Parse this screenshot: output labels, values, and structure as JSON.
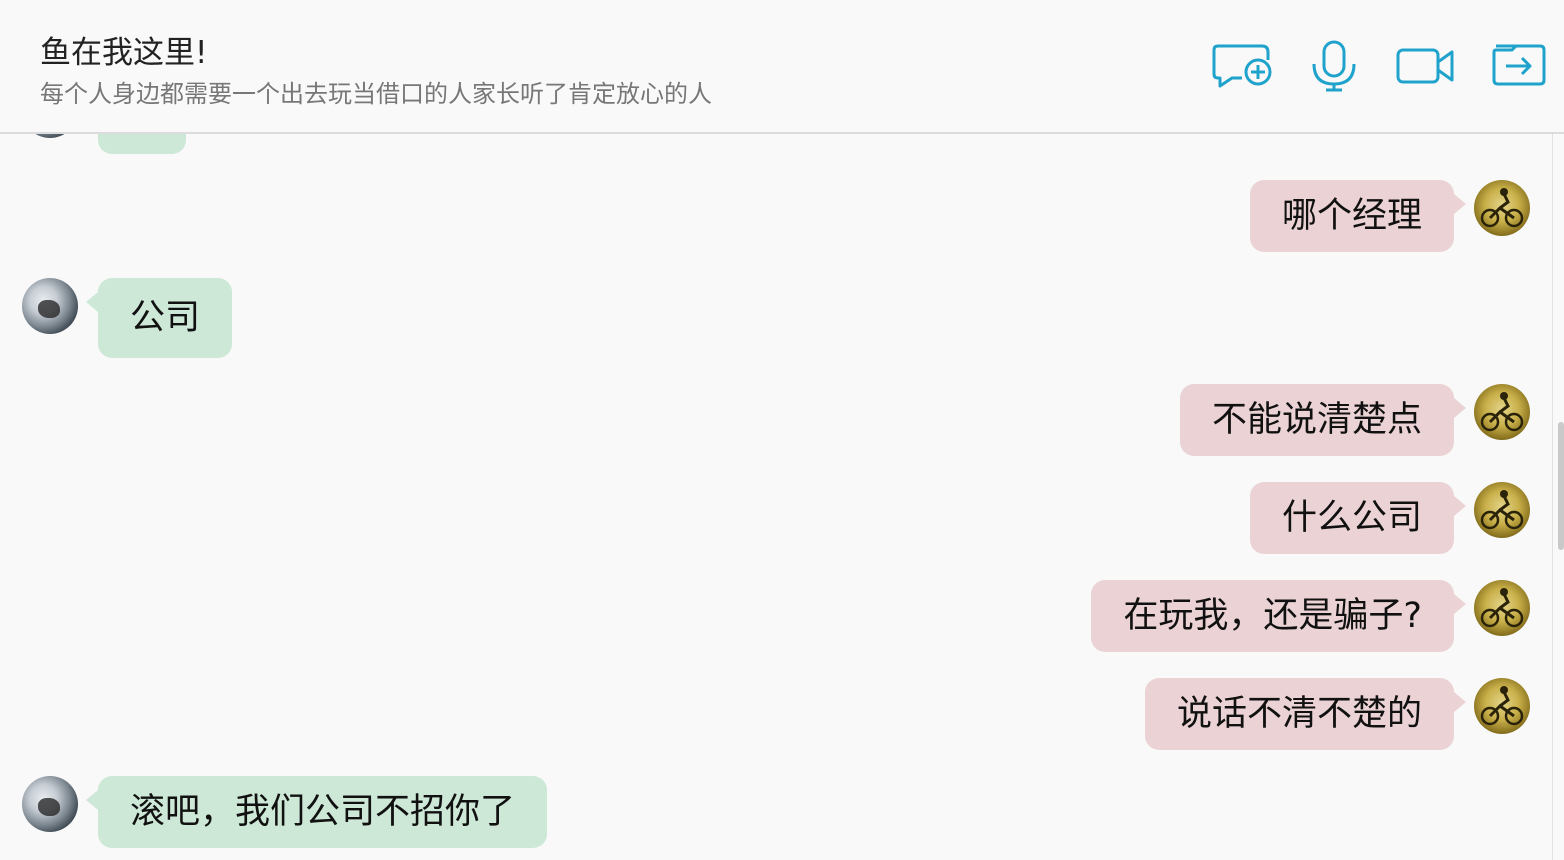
{
  "header": {
    "title": "鱼在我这里!",
    "subtitle": "每个人身边都需要一个出去玩当借口的人家长听了肯定放心的人",
    "accent_color": "#1fa2cc",
    "actions": [
      {
        "name": "new-chat",
        "icon": "chat-bubble-plus-icon"
      },
      {
        "name": "voice-call",
        "icon": "microphone-icon"
      },
      {
        "name": "video-call",
        "icon": "video-camera-icon"
      },
      {
        "name": "share",
        "icon": "arrow-right-box-icon"
      }
    ]
  },
  "messages": [
    {
      "side": "right",
      "text": "哪个经理"
    },
    {
      "side": "left",
      "text": "公司"
    },
    {
      "side": "right",
      "text": "不能说清楚点"
    },
    {
      "side": "right",
      "text": "什么公司"
    },
    {
      "side": "right",
      "text": "在玩我，还是骗子?"
    },
    {
      "side": "right",
      "text": "说话不清不楚的"
    },
    {
      "side": "left",
      "text": "滚吧，我们公司不招你了"
    }
  ],
  "colors": {
    "left_bubble": "#cde8d7",
    "right_bubble": "#ebd3d5",
    "background": "#f9f9f9"
  }
}
